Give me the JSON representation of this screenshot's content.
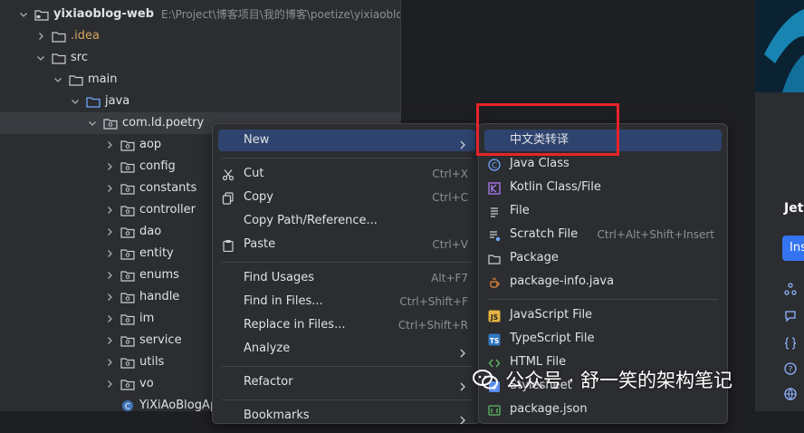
{
  "project": {
    "name": "yixiaoblog-web",
    "path": "E:\\Project\\博客项目\\我的博客\\poetize\\yixiaoblog-serv"
  },
  "tree": [
    {
      "label": "yixiaoblog-web",
      "depth": 0,
      "expanded": true,
      "kind": "module"
    },
    {
      "label": ".idea",
      "depth": 1,
      "expanded": false,
      "kind": "folder"
    },
    {
      "label": "src",
      "depth": 1,
      "expanded": true,
      "kind": "folder"
    },
    {
      "label": "main",
      "depth": 2,
      "expanded": true,
      "kind": "folder"
    },
    {
      "label": "java",
      "depth": 3,
      "expanded": true,
      "kind": "source"
    },
    {
      "label": "com.ld.poetry",
      "depth": 4,
      "expanded": true,
      "kind": "package",
      "selected": true
    },
    {
      "label": "aop",
      "depth": 5,
      "expanded": false,
      "kind": "package"
    },
    {
      "label": "config",
      "depth": 5,
      "expanded": false,
      "kind": "package"
    },
    {
      "label": "constants",
      "depth": 5,
      "expanded": false,
      "kind": "package"
    },
    {
      "label": "controller",
      "depth": 5,
      "expanded": false,
      "kind": "package"
    },
    {
      "label": "dao",
      "depth": 5,
      "expanded": false,
      "kind": "package"
    },
    {
      "label": "entity",
      "depth": 5,
      "expanded": false,
      "kind": "package"
    },
    {
      "label": "enums",
      "depth": 5,
      "expanded": false,
      "kind": "package"
    },
    {
      "label": "handle",
      "depth": 5,
      "expanded": false,
      "kind": "package"
    },
    {
      "label": "im",
      "depth": 5,
      "expanded": false,
      "kind": "package"
    },
    {
      "label": "service",
      "depth": 5,
      "expanded": false,
      "kind": "package"
    },
    {
      "label": "utils",
      "depth": 5,
      "expanded": false,
      "kind": "package"
    },
    {
      "label": "vo",
      "depth": 5,
      "expanded": false,
      "kind": "package"
    },
    {
      "label": "YiXiAoBlogApplic",
      "depth": 5,
      "expanded": false,
      "kind": "class"
    }
  ],
  "context_menu": [
    {
      "type": "item",
      "label": "New",
      "shortcut": "",
      "submenu": true,
      "highlighted": true,
      "icon": ""
    },
    {
      "type": "sep"
    },
    {
      "type": "item",
      "label": "Cut",
      "shortcut": "Ctrl+X",
      "icon": "scissors-icon"
    },
    {
      "type": "item",
      "label": "Copy",
      "shortcut": "Ctrl+C",
      "icon": "copy-icon"
    },
    {
      "type": "item",
      "label": "Copy Path/Reference...",
      "shortcut": "",
      "icon": ""
    },
    {
      "type": "item",
      "label": "Paste",
      "shortcut": "Ctrl+V",
      "icon": "paste-icon"
    },
    {
      "type": "sep"
    },
    {
      "type": "item",
      "label": "Find Usages",
      "shortcut": "Alt+F7",
      "icon": ""
    },
    {
      "type": "item",
      "label": "Find in Files...",
      "shortcut": "Ctrl+Shift+F",
      "icon": ""
    },
    {
      "type": "item",
      "label": "Replace in Files...",
      "shortcut": "Ctrl+Shift+R",
      "icon": ""
    },
    {
      "type": "item",
      "label": "Analyze",
      "shortcut": "",
      "submenu": true,
      "icon": ""
    },
    {
      "type": "sep"
    },
    {
      "type": "item",
      "label": "Refactor",
      "shortcut": "",
      "submenu": true,
      "icon": ""
    },
    {
      "type": "sep"
    },
    {
      "type": "item",
      "label": "Bookmarks",
      "shortcut": "",
      "submenu": true,
      "icon": ""
    }
  ],
  "new_submenu": [
    {
      "type": "item",
      "label": "中文类转译",
      "shortcut": "",
      "highlighted": true,
      "icon": ""
    },
    {
      "type": "item",
      "label": "Java Class",
      "shortcut": "",
      "icon": "java-class-icon"
    },
    {
      "type": "item",
      "label": "Kotlin Class/File",
      "shortcut": "",
      "icon": "kotlin-icon"
    },
    {
      "type": "item",
      "label": "File",
      "shortcut": "",
      "icon": "file-icon"
    },
    {
      "type": "item",
      "label": "Scratch File",
      "shortcut": "Ctrl+Alt+Shift+Insert",
      "icon": "scratch-file-icon"
    },
    {
      "type": "item",
      "label": "Package",
      "shortcut": "",
      "icon": "package-icon"
    },
    {
      "type": "item",
      "label": "package-info.java",
      "shortcut": "",
      "icon": "java-file-icon"
    },
    {
      "type": "sep"
    },
    {
      "type": "item",
      "label": "JavaScript File",
      "shortcut": "",
      "icon": "javascript-icon"
    },
    {
      "type": "item",
      "label": "TypeScript File",
      "shortcut": "",
      "icon": "typescript-icon"
    },
    {
      "type": "item",
      "label": "HTML File",
      "shortcut": "",
      "icon": "html-icon"
    },
    {
      "type": "item",
      "label": "Stylesheet",
      "shortcut": "",
      "icon": "stylesheet-icon"
    },
    {
      "type": "item",
      "label": "package.json",
      "shortcut": "",
      "icon": "npm-icon"
    }
  ],
  "right_panel": {
    "heading": "Jet",
    "button_label": "Ins"
  },
  "watermark": {
    "text": "公众号 · 舒一笑的架构笔记"
  },
  "colors": {
    "highlight": "#2e436e",
    "selection": "#393b40",
    "annotation_box": "#e8232a",
    "accent": "#3574f0"
  }
}
